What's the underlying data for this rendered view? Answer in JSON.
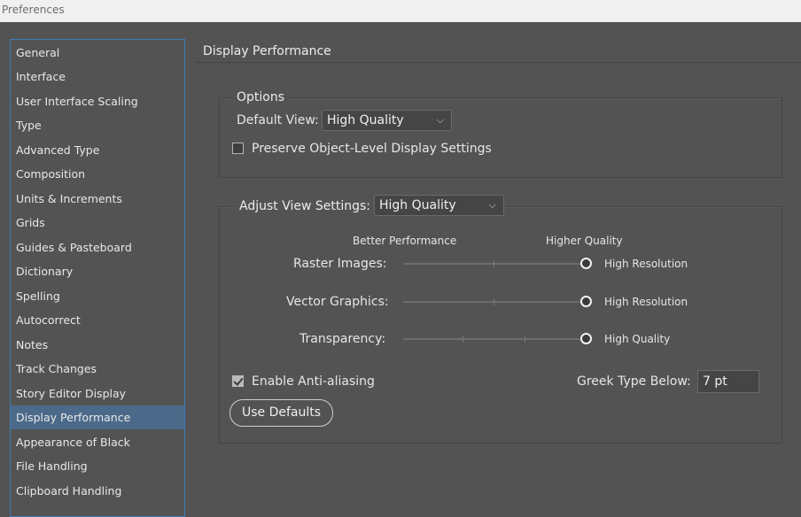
{
  "window": {
    "title": "Preferences"
  },
  "sidebar": {
    "items": [
      {
        "label": "General"
      },
      {
        "label": "Interface"
      },
      {
        "label": "User Interface Scaling"
      },
      {
        "label": "Type"
      },
      {
        "label": "Advanced Type"
      },
      {
        "label": "Composition"
      },
      {
        "label": "Units & Increments"
      },
      {
        "label": "Grids"
      },
      {
        "label": "Guides & Pasteboard"
      },
      {
        "label": "Dictionary"
      },
      {
        "label": "Spelling"
      },
      {
        "label": "Autocorrect"
      },
      {
        "label": "Notes"
      },
      {
        "label": "Track Changes"
      },
      {
        "label": "Story Editor Display"
      },
      {
        "label": "Display Performance",
        "selected": true
      },
      {
        "label": "Appearance of Black"
      },
      {
        "label": "File Handling"
      },
      {
        "label": "Clipboard Handling"
      }
    ]
  },
  "main": {
    "title": "Display Performance",
    "options": {
      "legend": "Options",
      "default_view_label": "Default View:",
      "default_view_value": "High Quality",
      "preserve_label": "Preserve Object-Level Display Settings",
      "preserve_checked": false
    },
    "adjust": {
      "label": "Adjust View Settings:",
      "value": "High Quality",
      "better_performance": "Better Performance",
      "higher_quality": "Higher Quality",
      "raster_label": "Raster Images:",
      "raster_value": "High Resolution",
      "raster_level": 1.0,
      "vector_label": "Vector Graphics:",
      "vector_value": "High Resolution",
      "vector_level": 1.0,
      "transparency_label": "Transparency:",
      "transparency_value": "High Quality",
      "transparency_level": 1.0,
      "anti_alias_label": "Enable Anti-aliasing",
      "anti_alias_checked": true,
      "greek_label": "Greek Type Below:",
      "greek_value": "7 pt",
      "defaults_button": "Use Defaults"
    }
  },
  "colors": {
    "background": "#535353",
    "selected_item": "#4b6a8a",
    "sidebar_border": "#3c7ab8"
  }
}
